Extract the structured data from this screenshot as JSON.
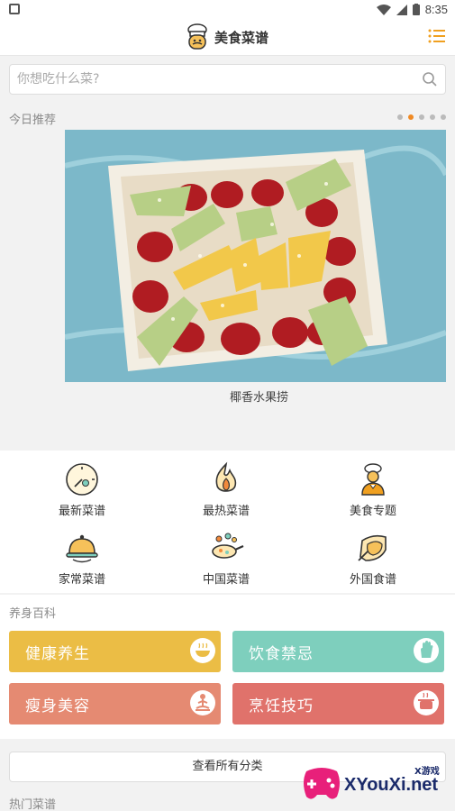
{
  "status_bar": {
    "time": "8:35"
  },
  "header": {
    "title": "美食菜谱"
  },
  "search": {
    "placeholder": "你想吃什么菜?"
  },
  "today": {
    "section_title": "今日推荐",
    "carousel_total": 5,
    "carousel_active": 2,
    "caption": "椰香水果捞"
  },
  "categories": [
    {
      "label": "最新菜谱",
      "icon": "clock-fork-icon"
    },
    {
      "label": "最热菜谱",
      "icon": "flame-icon"
    },
    {
      "label": "美食专题",
      "icon": "chef-icon"
    },
    {
      "label": "家常菜谱",
      "icon": "cloche-icon"
    },
    {
      "label": "中国菜谱",
      "icon": "pan-icon"
    },
    {
      "label": "外国食谱",
      "icon": "chicken-icon"
    }
  ],
  "health": {
    "section_title": "养身百科",
    "tiles": [
      {
        "label": "健康养生",
        "color": "#ebbd45",
        "icon": "bowl-icon"
      },
      {
        "label": "饮食禁忌",
        "color": "#7ecfbd",
        "icon": "stop-hand-icon"
      },
      {
        "label": "瘦身美容",
        "color": "#e58a72",
        "icon": "meditation-icon"
      },
      {
        "label": "烹饪技巧",
        "color": "#e0726b",
        "icon": "pot-icon"
      }
    ]
  },
  "all_categories": {
    "label": "查看所有分类"
  },
  "hot": {
    "section_title": "热门菜谱"
  },
  "watermark": {
    "text": "XYouXi.net",
    "small": "X游戏"
  }
}
